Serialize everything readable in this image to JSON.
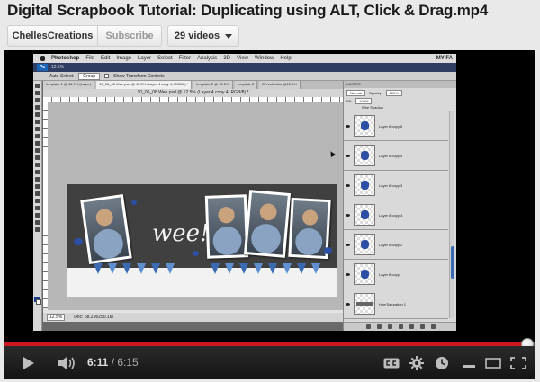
{
  "page": {
    "title": "Digital Scrapbook Tutorial: Duplicating using ALT, Click & Drag.mp4",
    "channel_button": "ChellesCreations",
    "subscribe_button": "Subscribe",
    "videos_button": "29 videos"
  },
  "video_frame": {
    "mac_menu": {
      "app": "Photoshop",
      "items": [
        "File",
        "Edit",
        "Image",
        "Layer",
        "Select",
        "Filter",
        "Analysis",
        "3D",
        "View",
        "Window",
        "Help"
      ],
      "right_label": "MY FA"
    },
    "app_bar": {
      "logo": "Ps",
      "zoom": "12.5%"
    },
    "options_bar": {
      "auto_select_label": "Auto-Select:",
      "auto_select_value": "Group",
      "transform_label": "Show Transform Controls"
    },
    "doc_tabs": [
      "template 1 @ 16.7% (Layer)",
      "10_06_08 Wee.psd @ 12.5% (Layer 4 copy 4, RGB/8) *",
      "template 2 @ 12.5%",
      "template 3",
      "DIYcollection@12.5%"
    ],
    "doc_title": "10_06_08 Wee.psd @ 12.5% (Layer 4 copy 4, RGB/8) *",
    "canvas_text": "wee!",
    "status_bar": {
      "zoom": "12.5%",
      "doc": "Doc: 68.2M/250.1M"
    },
    "layers_panel": {
      "title": "LAYERS",
      "blend_mode": "Normal",
      "opacity_label": "Opacity:",
      "opacity_value": "100%",
      "fill_label": "Fill:",
      "fill_value": "100%",
      "group_name": "Wee Shadow",
      "layers": [
        {
          "name": "Layer 8 copy 6",
          "kind": "splat"
        },
        {
          "name": "Layer 8 copy 5",
          "kind": "splat"
        },
        {
          "name": "Layer 8 copy 3",
          "kind": "splat"
        },
        {
          "name": "Layer 8 copy 4",
          "kind": "splat"
        },
        {
          "name": "Layer 8 copy 2",
          "kind": "splat"
        },
        {
          "name": "Layer 8 copy",
          "kind": "splat"
        },
        {
          "name": "Hue/Saturation 1",
          "kind": "adjust"
        }
      ]
    }
  },
  "player": {
    "current_time": "6:11",
    "duration": "6:15",
    "progress_fraction": 0.984
  },
  "colors": {
    "progress_played": "#cc181e",
    "splat_blue": "#2c4fa5"
  }
}
